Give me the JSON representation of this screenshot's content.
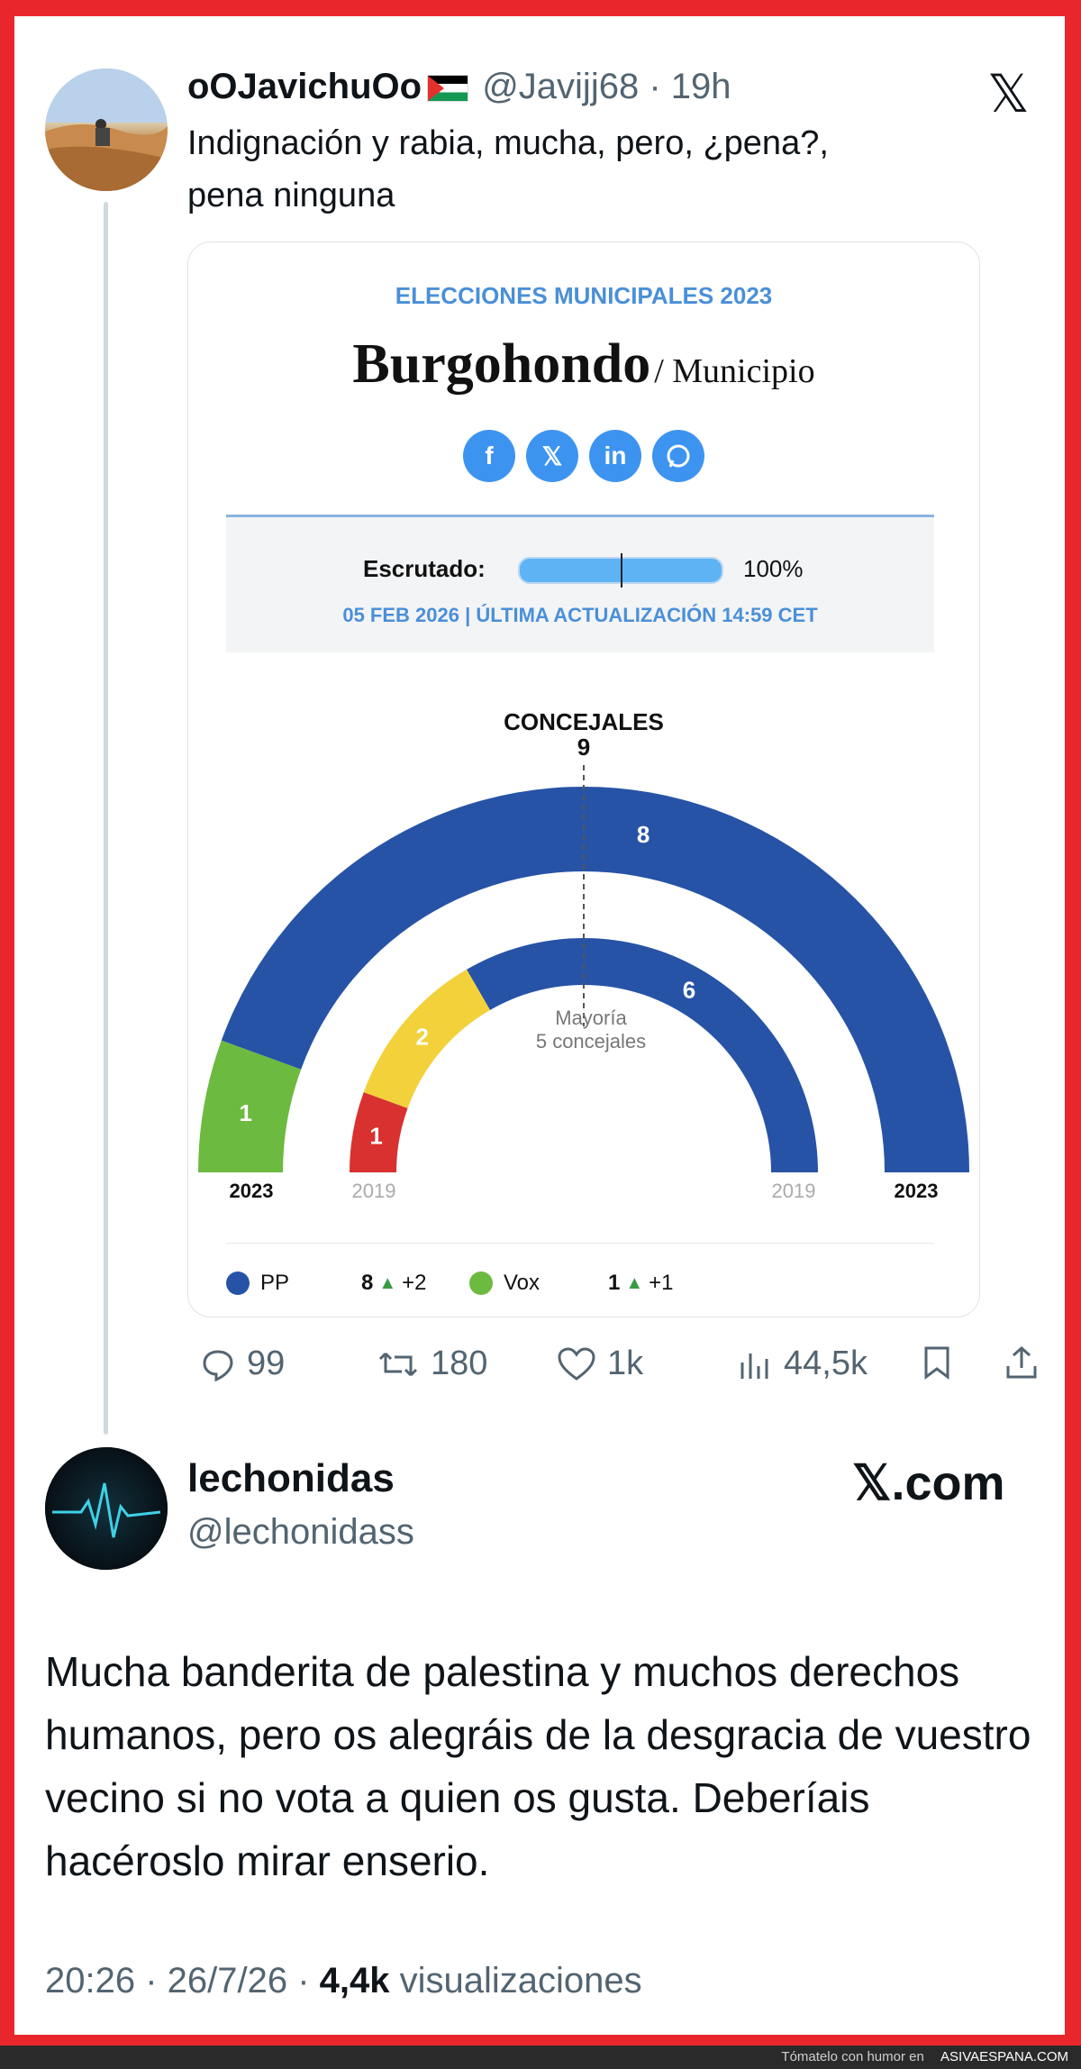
{
  "tweet1": {
    "display_name": "oOJavichuOo",
    "handle": "@Javijj68",
    "time": "19h",
    "text_line1": "Indignación y rabia, mucha, pero, ¿pena?,",
    "text_line2": "pena ninguna",
    "stats": {
      "replies": "99",
      "retweets": "180",
      "likes": "1k",
      "views": "44,5k"
    }
  },
  "card": {
    "kicker": "ELECCIONES MUNICIPALES 2023",
    "municipality": "Burgohondo",
    "municipality_suffix": "/ Municipio",
    "share_icons": [
      "facebook-icon",
      "x-icon",
      "linkedin-icon",
      "whatsapp-icon"
    ],
    "scrutiny_label": "Escrutado:",
    "scrutiny_percent": "100%",
    "scrutiny_fraction": 1.0,
    "updated": "05 FEB 2026 | ÚLTIMA ACTUALIZACIÓN 14:59 CET",
    "council_label": "CONCEJALES",
    "council_total": "9",
    "majority_line1": "Mayoría",
    "majority_line2": "5 concejales",
    "legend": [
      {
        "party": "PP",
        "seats": "8",
        "change": "+2",
        "color": "#2753a6"
      },
      {
        "party": "Vox",
        "seats": "1",
        "change": "+1",
        "color": "#6cba3f"
      }
    ]
  },
  "chart_data": {
    "type": "parliament-hemicycle",
    "total_seats": 9,
    "majority": 5,
    "rings": [
      {
        "year": "2023",
        "segments": [
          {
            "party": "Vox",
            "seats": 1,
            "color": "#6cba3f"
          },
          {
            "party": "PP",
            "seats": 8,
            "color": "#2753a6"
          }
        ]
      },
      {
        "year": "2019",
        "segments": [
          {
            "party": "",
            "seats": 1,
            "color": "#d8312f"
          },
          {
            "party": "",
            "seats": 2,
            "color": "#f2d13a"
          },
          {
            "party": "PP",
            "seats": 6,
            "color": "#2753a6"
          }
        ]
      }
    ]
  },
  "tweet2": {
    "display_name": "lechonidas",
    "handle": "@lechonidass",
    "brand": "𝕏.com",
    "text": "Mucha banderita de palestina y muchos derechos humanos, pero os alegráis de la desgracia de vuestro vecino si no vota a quien os gusta. Deberíais hacéroslo mirar enserio.",
    "time": "20:26 · 26/7/26 · ",
    "views_count": "4,4k",
    "views_label": " visualizaciones"
  },
  "footer": {
    "text": "Tómatelo con humor en ",
    "site": "ASIVAESPANA.COM"
  }
}
